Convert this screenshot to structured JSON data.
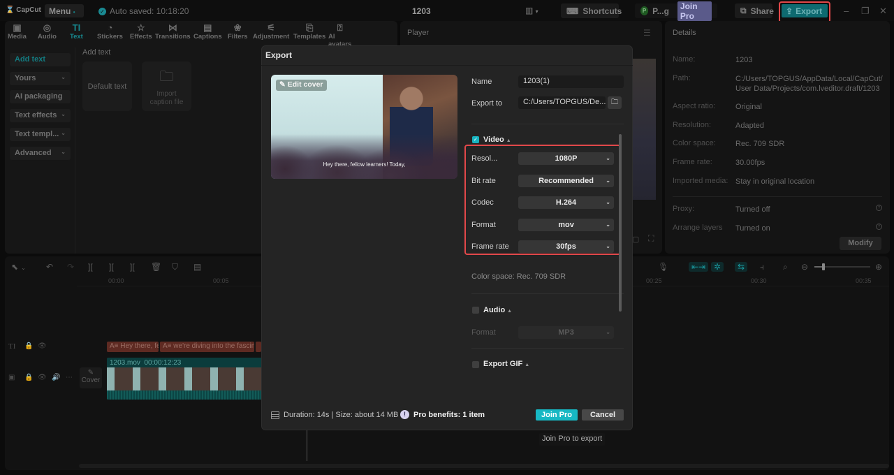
{
  "app": {
    "logo": "CapCut",
    "menu_label": "Menu",
    "autosave": "Auto saved: 10:18:20",
    "project_title": "1203",
    "shortcuts_label": "Shortcuts",
    "user_initial": "P",
    "user_name": "P...g",
    "join_pro_label": "Join Pro",
    "share_label": "Share",
    "export_label": "Export",
    "accent_color": "#17b8c4",
    "highlight_color": "#e2484a"
  },
  "tool_tabs": [
    {
      "label": "Media",
      "icon": "media-icon",
      "glyph": "▣"
    },
    {
      "label": "Audio",
      "icon": "audio-icon",
      "glyph": "◎"
    },
    {
      "label": "Text",
      "icon": "text-icon",
      "glyph": "TI",
      "active": true
    },
    {
      "label": "Stickers",
      "icon": "stickers-icon",
      "glyph": "◔"
    },
    {
      "label": "Effects",
      "icon": "effects-icon",
      "glyph": "☆"
    },
    {
      "label": "Transitions",
      "icon": "transitions-icon",
      "glyph": "⋈"
    },
    {
      "label": "Captions",
      "icon": "captions-icon",
      "glyph": "▤"
    },
    {
      "label": "Filters",
      "icon": "filters-icon",
      "glyph": "❀"
    },
    {
      "label": "Adjustment",
      "icon": "adjustment-icon",
      "glyph": "⚟"
    },
    {
      "label": "Templates",
      "icon": "templates-icon",
      "glyph": "⎘"
    },
    {
      "label": "AI avatars",
      "icon": "ai-avatars-icon",
      "glyph": "⍰"
    }
  ],
  "text_categories": [
    {
      "label": "Add text",
      "active": true,
      "chevron": false
    },
    {
      "label": "Yours",
      "chevron": true
    },
    {
      "label": "AI packaging",
      "chevron": false
    },
    {
      "label": "Text effects",
      "chevron": true
    },
    {
      "label": "Text templ...",
      "chevron": true
    },
    {
      "label": "Advanced",
      "chevron": true
    }
  ],
  "add_text": {
    "section_label": "Add text",
    "default_text": "Default text",
    "import_caption": "Import caption file"
  },
  "player": {
    "title": "Player"
  },
  "details": {
    "title": "Details",
    "rows": [
      {
        "label": "Name:",
        "value": "1203"
      },
      {
        "label": "Path:",
        "value": "C:/Users/TOPGUS/AppData/Local/CapCut/ User Data/Projects/com.lveditor.draft/1203"
      },
      {
        "label": "Aspect ratio:",
        "value": "Original"
      },
      {
        "label": "Resolution:",
        "value": "Adapted"
      },
      {
        "label": "Color space:",
        "value": "Rec. 709 SDR"
      },
      {
        "label": "Frame rate:",
        "value": "30.00fps"
      },
      {
        "label": "Imported media:",
        "value": "Stay in original location"
      },
      {
        "label": "Proxy:",
        "value": "Turned off"
      },
      {
        "label": "Arrange layers",
        "value": "Turned on"
      }
    ],
    "modify_label": "Modify"
  },
  "timeline": {
    "ticks": [
      "00:00",
      "00:05",
      "00:25",
      "00:30",
      "00:35"
    ],
    "text_clips": [
      "Hey there, fe",
      "we're diving into the fascin"
    ],
    "text_clip_badge": "A≡",
    "video_clip": {
      "name": "1203.mov",
      "duration": "00:00:12:23"
    },
    "cover_label": "Cover"
  },
  "export_dialog": {
    "title": "Export",
    "edit_cover_label": "Edit cover",
    "cover_caption": "Hey there, fellow learners! Today,",
    "name_label": "Name",
    "name_value": "1203(1)",
    "export_to_label": "Export to",
    "export_to_value": "C:/Users/TOPGUS/De...",
    "video": {
      "label": "Video",
      "checked": true,
      "settings": [
        {
          "label": "Resol...",
          "value": "1080P"
        },
        {
          "label": "Bit rate",
          "value": "Recommended"
        },
        {
          "label": "Codec",
          "value": "H.264"
        },
        {
          "label": "Format",
          "value": "mov"
        },
        {
          "label": "Frame rate",
          "value": "30fps"
        }
      ],
      "color_space": "Color space: Rec. 709 SDR"
    },
    "audio": {
      "label": "Audio",
      "checked": false,
      "format_label": "Format",
      "format_value": "MP3"
    },
    "gif": {
      "label": "Export GIF",
      "checked": false
    },
    "footer": {
      "info": "Duration: 14s | Size: about 14 MB",
      "pro_benefits": "Pro benefits: 1 item",
      "join_pro_label": "Join Pro",
      "cancel_label": "Cancel",
      "tooltip": "Join Pro to export"
    }
  }
}
